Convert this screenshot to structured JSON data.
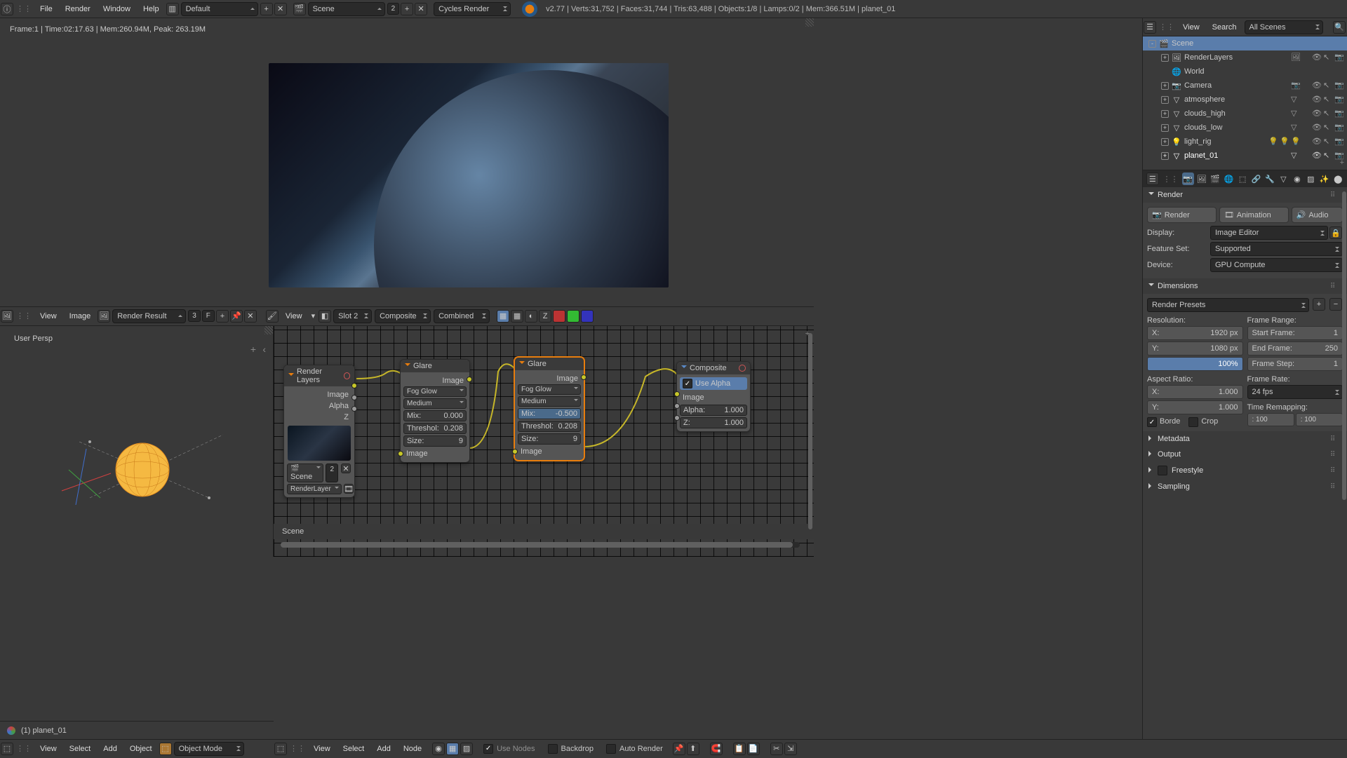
{
  "topbar": {
    "menus": [
      "File",
      "Render",
      "Window",
      "Help"
    ],
    "layout": "Default",
    "scene": "Scene",
    "scene_count": "2",
    "engine": "Cycles Render",
    "version": "v2.77",
    "stats": "Verts:31,752 | Faces:31,744 | Tris:63,488 | Objects:1/8 | Lamps:0/2 | Mem:366.51M | planet_01"
  },
  "image_editor": {
    "frame_info": "Frame:1 | Time:02:17.63 | Mem:260.94M, Peak: 263.19M",
    "view": "View",
    "image": "Image",
    "result": "Render Result",
    "result_users": "3",
    "f": "F",
    "slot": "Slot 2",
    "pass_type": "Composite",
    "pass": "Combined",
    "view_menu": "View"
  },
  "viewport3d": {
    "label": "User Persp",
    "footer_object": "(1) planet_01",
    "view": "View",
    "select": "Select",
    "add": "Add",
    "object": "Object",
    "mode": "Object Mode"
  },
  "node_editor": {
    "scene_label": "Scene",
    "view": "View",
    "select": "Select",
    "add": "Add",
    "node": "Node",
    "use_nodes": "Use Nodes",
    "backdrop": "Backdrop",
    "auto_render": "Auto Render",
    "menu_view": "View",
    "nodes": {
      "renderlayers": {
        "title": "Render Layers",
        "outs": [
          "Image",
          "Alpha",
          "Z"
        ],
        "scene": "Scene",
        "scene_n": "2",
        "layer": "RenderLayer"
      },
      "glare1": {
        "title": "Glare",
        "img_out": "Image",
        "img_in": "Image",
        "type": "Fog Glow",
        "quality": "Medium",
        "mix_l": "Mix:",
        "mix": "0.000",
        "thr_l": "Threshol:",
        "thr": "0.208",
        "size_l": "Size:",
        "size": "9"
      },
      "glare2": {
        "title": "Glare",
        "img_out": "Image",
        "img_in": "Image",
        "type": "Fog Glow",
        "quality": "Medium",
        "mix_l": "Mix:",
        "mix": "-0.500",
        "thr_l": "Threshol:",
        "thr": "0.208",
        "size_l": "Size:",
        "size": "9"
      },
      "composite": {
        "title": "Composite",
        "use_alpha": "Use Alpha",
        "img": "Image",
        "alpha_l": "Alpha:",
        "alpha": "1.000",
        "z_l": "Z:",
        "z": "1.000"
      }
    }
  },
  "outliner": {
    "view": "View",
    "search": "Search",
    "filter": "All Scenes",
    "items": [
      {
        "name": "Scene",
        "icon": "scene",
        "depth": 0,
        "sel": true,
        "exp": "-"
      },
      {
        "name": "RenderLayers",
        "icon": "renderlayers",
        "depth": 1,
        "exp": "+",
        "right": [
          "render-icon"
        ]
      },
      {
        "name": "World",
        "icon": "world",
        "depth": 1
      },
      {
        "name": "Camera",
        "icon": "camera",
        "depth": 1,
        "exp": "+",
        "right": [
          "eye",
          "cursor",
          "render"
        ]
      },
      {
        "name": "atmosphere",
        "icon": "mesh",
        "depth": 1,
        "exp": "+",
        "right": [
          "eye",
          "cursor",
          "render"
        ]
      },
      {
        "name": "clouds_high",
        "icon": "mesh",
        "depth": 1,
        "exp": "+",
        "right": [
          "eye",
          "cursor",
          "render"
        ]
      },
      {
        "name": "clouds_low",
        "icon": "mesh",
        "depth": 1,
        "exp": "+",
        "right": [
          "eye",
          "cursor",
          "render"
        ]
      },
      {
        "name": "light_rig",
        "icon": "lights",
        "depth": 1,
        "exp": "+",
        "right": [
          "eye",
          "cursor",
          "render"
        ]
      },
      {
        "name": "planet_01",
        "icon": "mesh",
        "depth": 1,
        "exp": "+",
        "act": true,
        "right": [
          "eye",
          "cursor",
          "render"
        ]
      }
    ]
  },
  "props": {
    "render": {
      "title": "Render",
      "render_btn": "Render",
      "anim_btn": "Animation",
      "audio_btn": "Audio",
      "display_l": "Display:",
      "display": "Image Editor",
      "feature_l": "Feature Set:",
      "feature": "Supported",
      "device_l": "Device:",
      "device": "GPU Compute"
    },
    "dimensions": {
      "title": "Dimensions",
      "presets": "Render Presets",
      "res_l": "Resolution:",
      "x_l": "X:",
      "x": "1920 px",
      "y_l": "Y:",
      "y": "1080 px",
      "pct": "100%",
      "frange_l": "Frame Range:",
      "sf_l": "Start Frame:",
      "sf": "1",
      "ef_l": "End Frame:",
      "ef": "250",
      "fs_l": "Frame Step:",
      "fs": "1",
      "ar_l": "Aspect Ratio:",
      "arx_l": "X:",
      "arx": "1.000",
      "ary_l": "Y:",
      "ary": "1.000",
      "fr_l": "Frame Rate:",
      "fr": "24 fps",
      "tr_l": "Time Remapping:",
      "tr1": " : 100",
      "tr2": " : 100",
      "border": "Borde",
      "crop": "Crop"
    },
    "metadata": "Metadata",
    "output": "Output",
    "freestyle": "Freestyle",
    "sampling": "Sampling"
  }
}
